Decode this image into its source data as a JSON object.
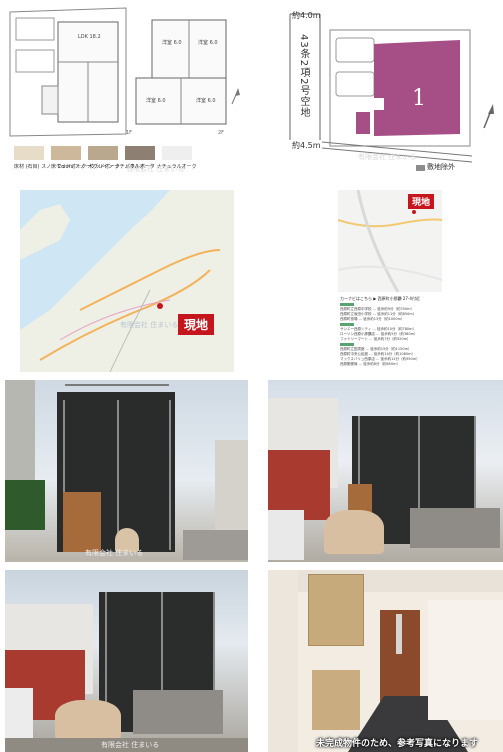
{
  "floorplan": {
    "rooms": [
      "LDK\n18.2畳",
      "洋室\n6.0畳",
      "洋室\n6.0畳",
      "洋室\n6.0畳",
      "洋室\n6.0畳"
    ],
    "swatches": [
      {
        "label": "床材 (石目)\nスノーウッドオーク",
        "color": "#e7dcc7"
      },
      {
        "label": "床 Colors\nスノーウッドオーク",
        "color": "#cdb89c"
      },
      {
        "label": "木グレイン\nナチュラルオーク",
        "color": "#b9a88d"
      },
      {
        "label": "パネルボード\nナチュラルオーク",
        "color": "#8d7f72"
      },
      {
        "label": "",
        "color": "#efefef"
      }
    ],
    "watermark": "有限会社 住まいる"
  },
  "site_plan": {
    "width_top": "約4.0m",
    "road_label": "43条2項2号空地",
    "width_bottom": "約4.5m",
    "lot_number": "1",
    "outside_label": "敷地除外",
    "accent": "#a64f86"
  },
  "map_wide": {
    "label": "現地",
    "accent": "#c5161d"
  },
  "map_detail": {
    "label": "現地",
    "address": "カーナビはこちら ▶ 西原町小那覇 27-4付近",
    "rows": [
      "西原町立西原中学校 … 徒歩約9分（約700m）",
      "西原町立坂田小学校 … 徒歩約11分（約850m）",
      "西原町役場 … 徒歩約13分（約1000m）",
      "サンエー西原シティ … 徒歩約10分（約780m）",
      "ローソン西原小那覇店 … 徒歩約5分（約380m）",
      "ファミリーマート … 徒歩約7分（約520m）",
      "西原町立図書館 … 徒歩約15分（約1150m）",
      "西原町中央公民館 … 徒歩約14分（約1080m）",
      "マックスバリュ西原店 … 徒歩約12分（約950m）",
      "西原郵便局 … 徒歩約8分（約650m）"
    ]
  },
  "photos": {
    "watermark": "有限会社 住まいる",
    "entrance_caption": "未完成物件のため、参考写真になります"
  }
}
